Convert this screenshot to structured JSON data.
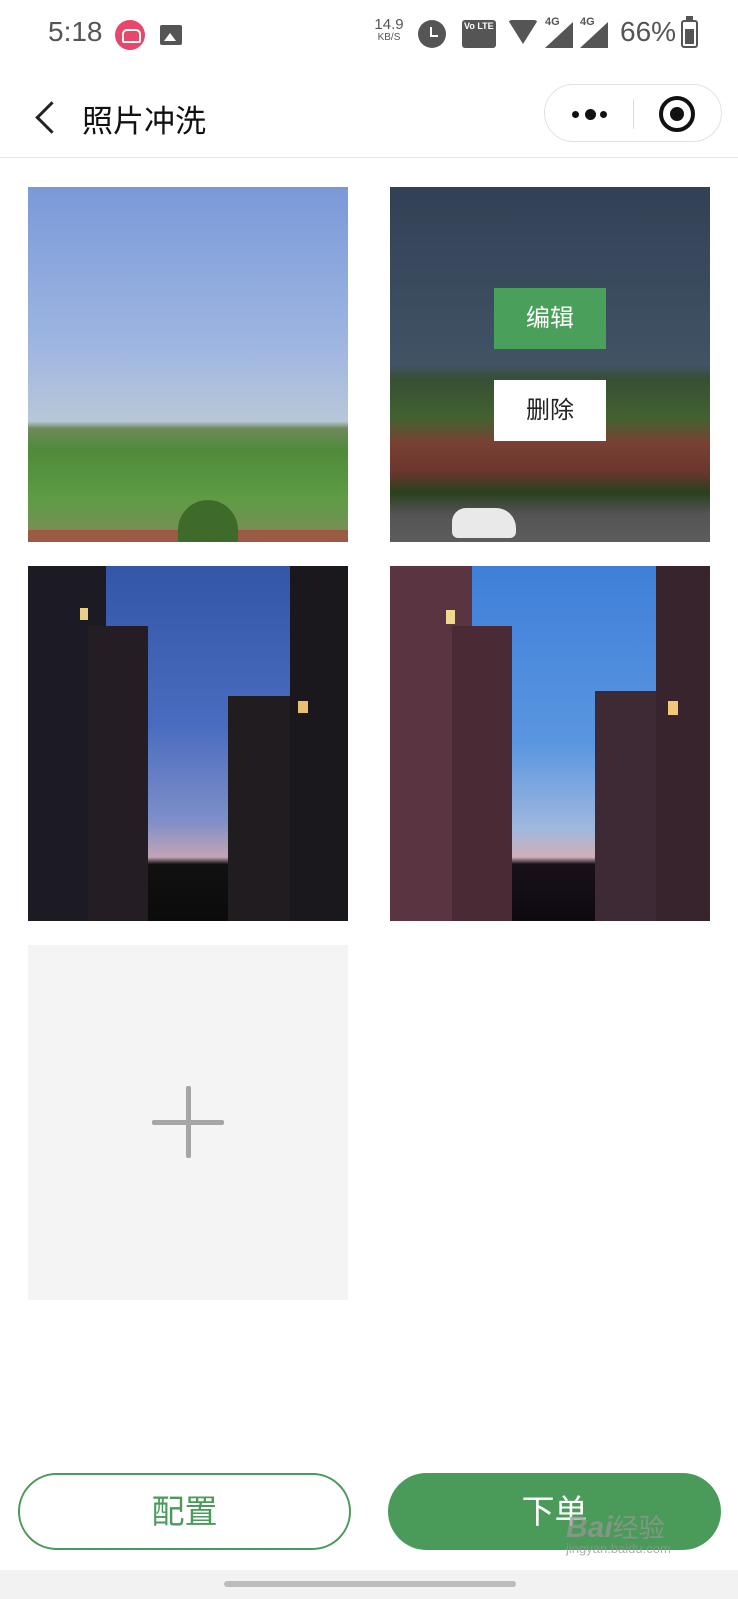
{
  "status_bar": {
    "time": "5:18",
    "net_speed": "14.9",
    "net_speed_unit": "KB/S",
    "volte": "Vo LTE",
    "sim1_type": "4G",
    "sim2_type": "4G",
    "battery_percent": "66%"
  },
  "nav": {
    "title": "照片冲洗"
  },
  "photos": [
    {
      "scene": "farm-field-sky"
    },
    {
      "scene": "field-garden-car",
      "selected": true
    },
    {
      "scene": "buildings-dusk-sky-dark"
    },
    {
      "scene": "buildings-dusk-sky-bright"
    }
  ],
  "overlay": {
    "edit_label": "编辑",
    "delete_label": "删除"
  },
  "actions": {
    "config_label": "配置",
    "order_label": "下单"
  },
  "watermark": {
    "brand": "Bai",
    "brand_suffix": "经验",
    "url": "jingyan.baidu.com"
  },
  "colors": {
    "accent": "#4a9a5a",
    "add_tile_bg": "#f4f4f4",
    "plus_icon": "#a6a6a6"
  }
}
